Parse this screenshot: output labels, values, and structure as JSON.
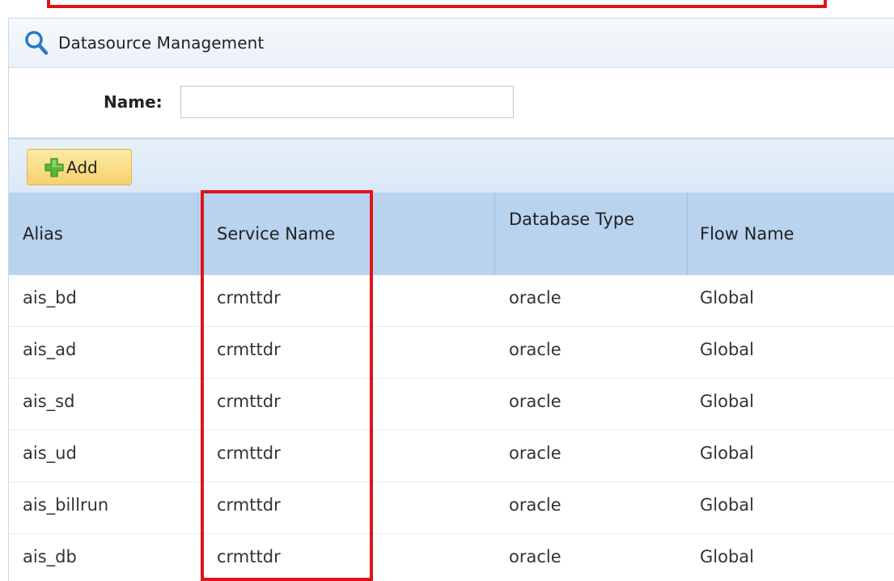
{
  "panel": {
    "title": "Datasource Management",
    "search": {
      "name_label": "Name:",
      "name_value": "",
      "name_placeholder": ""
    },
    "toolbar": {
      "add_label": "Add"
    }
  },
  "table": {
    "columns": [
      "Alias",
      "Service Name",
      "Database Type",
      "Flow Name"
    ],
    "rows": [
      {
        "alias": "ais_bd",
        "service_name": "crmttdr",
        "database_type": "oracle",
        "flow_name": "Global"
      },
      {
        "alias": "ais_ad",
        "service_name": "crmttdr",
        "database_type": "oracle",
        "flow_name": "Global"
      },
      {
        "alias": "ais_sd",
        "service_name": "crmttdr",
        "database_type": "oracle",
        "flow_name": "Global"
      },
      {
        "alias": "ais_ud",
        "service_name": "crmttdr",
        "database_type": "oracle",
        "flow_name": "Global"
      },
      {
        "alias": "ais_billrun",
        "service_name": "crmttdr",
        "database_type": "oracle",
        "flow_name": "Global"
      },
      {
        "alias": "ais_db",
        "service_name": "crmttdr",
        "database_type": "oracle",
        "flow_name": "Global"
      }
    ]
  },
  "icons": {
    "search": "search-icon",
    "add": "plus-icon"
  },
  "colors": {
    "annotation": "#e0131b",
    "header": "#b9d3ef",
    "add_button": "#f6d26a"
  }
}
